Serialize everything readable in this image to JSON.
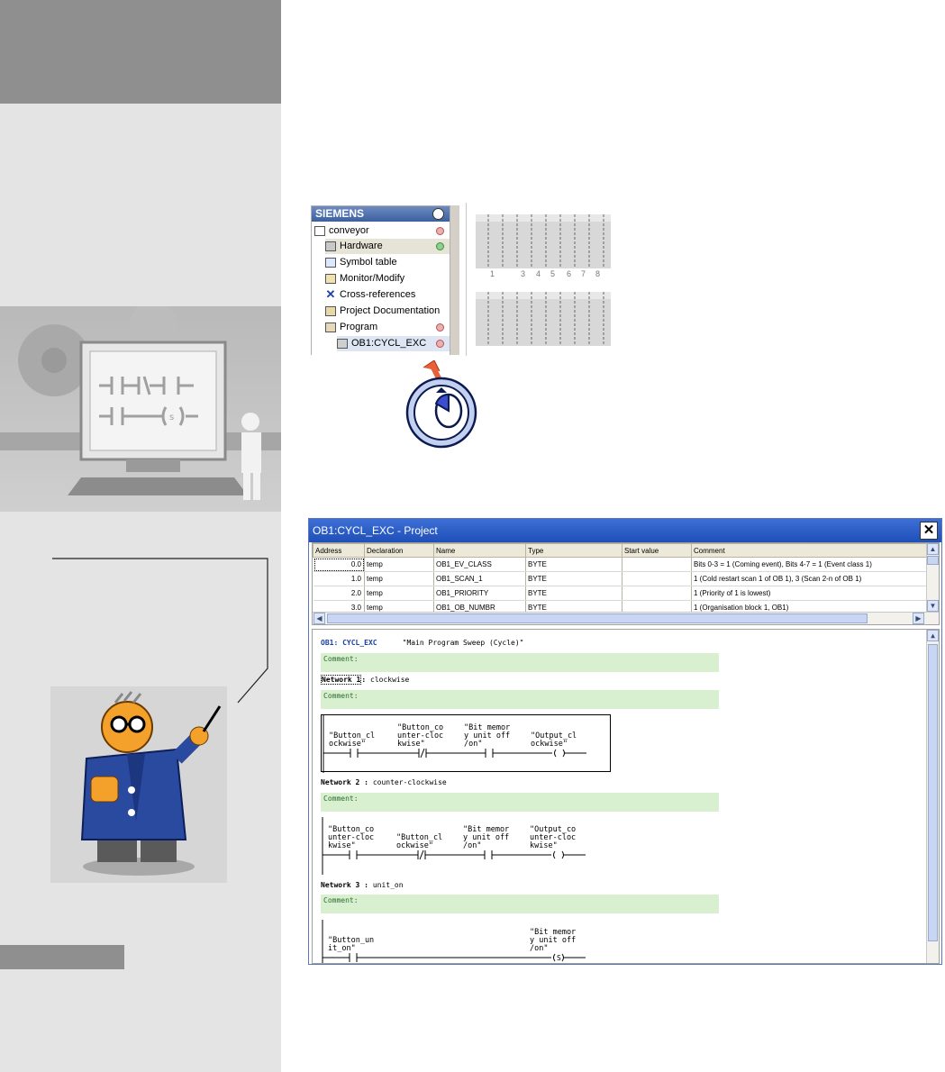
{
  "tree": {
    "brand": "SIEMENS",
    "items": [
      {
        "label": "conveyor",
        "icon": "project-icon",
        "status": "red"
      },
      {
        "label": "Hardware",
        "icon": "hardware-icon",
        "status": "green"
      },
      {
        "label": "Symbol table",
        "icon": "symbol-table-icon",
        "status": ""
      },
      {
        "label": "Monitor/Modify",
        "icon": "monitor-icon",
        "status": ""
      },
      {
        "label": "Cross-references",
        "icon": "cross-references-icon",
        "status": ""
      },
      {
        "label": "Project Documentation",
        "icon": "documentation-icon",
        "status": ""
      },
      {
        "label": "Program",
        "icon": "program-icon",
        "status": "red"
      },
      {
        "label": "OB1:CYCL_EXC",
        "icon": "block-icon",
        "status": "red"
      }
    ]
  },
  "racks": {
    "slot_labels": [
      "1",
      "3",
      "4",
      "5",
      "6",
      "7",
      "8"
    ]
  },
  "window": {
    "title": "OB1:CYCL_EXC  - Project",
    "close_label": "✕"
  },
  "declaration": {
    "columns": [
      "Address",
      "Declaration",
      "Name",
      "Type",
      "Start value",
      "Comment"
    ],
    "rows": [
      {
        "address": "0.0",
        "declaration": "temp",
        "name": "OB1_EV_CLASS",
        "type": "BYTE",
        "start": "",
        "comment": "Bits 0-3 = 1 (Coming event), Bits 4-7 = 1 (Event class 1)"
      },
      {
        "address": "1.0",
        "declaration": "temp",
        "name": "OB1_SCAN_1",
        "type": "BYTE",
        "start": "",
        "comment": "1 (Cold restart scan 1 of OB 1), 3 (Scan 2-n of OB 1)"
      },
      {
        "address": "2.0",
        "declaration": "temp",
        "name": "OB1_PRIORITY",
        "type": "BYTE",
        "start": "",
        "comment": "1 (Priority of 1 is lowest)"
      },
      {
        "address": "3.0",
        "declaration": "temp",
        "name": "OB1_OB_NUMBR",
        "type": "BYTE",
        "start": "",
        "comment": "1 (Organisation block 1, OB1)"
      }
    ]
  },
  "code": {
    "block_name": "OB1: CYCL_EXC",
    "block_title": "\"Main Program Sweep (Cycle)\"",
    "comment_label": "Comment:",
    "networks": [
      {
        "label": "Network 1",
        "title": "clockwise",
        "contacts": [
          {
            "line1": "\"Button_cl",
            "line2": "ockwise\"",
            "line3": "",
            "type": "NO"
          },
          {
            "line1": "\"Button_co",
            "line2": "unter-cloc",
            "line3": "kwise\"",
            "type": "NC"
          },
          {
            "line1": "\"Bit memor",
            "line2": "y unit off",
            "line3": "/on\"",
            "type": "NO"
          },
          {
            "line1": "\"Output_cl",
            "line2": "ockwise\"",
            "line3": "",
            "type": "COIL"
          }
        ]
      },
      {
        "label": "Network 2",
        "title": "counter-clockwise",
        "contacts": [
          {
            "line1": "\"Button_co",
            "line2": "unter-cloc",
            "line3": "kwise\"",
            "type": "NO"
          },
          {
            "line1": "\"Button_cl",
            "line2": "ockwise\"",
            "line3": "",
            "type": "NC"
          },
          {
            "line1": "\"Bit memor",
            "line2": "y unit off",
            "line3": "/on\"",
            "type": "NO"
          },
          {
            "line1": "\"Output_co",
            "line2": "unter-cloc",
            "line3": "kwise\"",
            "type": "COIL"
          }
        ]
      },
      {
        "label": "Network 3",
        "title": "unit_on",
        "contacts": [
          {
            "line1": "\"Button_un",
            "line2": "it_on\"",
            "line3": "",
            "type": "NO"
          },
          {
            "line1": "\"Bit memor",
            "line2": "y unit off",
            "line3": "/on\"",
            "type": "SET"
          }
        ]
      }
    ]
  },
  "colors": {
    "title_bar": "#2a5ac4",
    "comment_bg": "#d8f0d0",
    "sidebar": "#e4e4e4",
    "sidebar_dark": "#8f8f8f"
  }
}
